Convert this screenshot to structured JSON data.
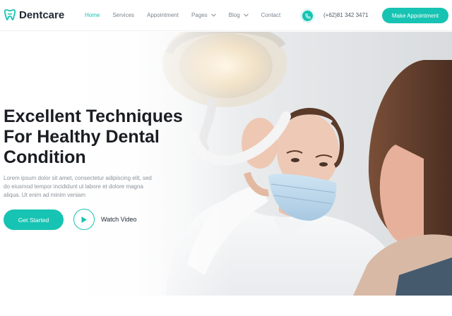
{
  "brand": {
    "name": "Dentcare"
  },
  "nav": {
    "items": [
      {
        "label": "Home",
        "active": true,
        "dropdown": false
      },
      {
        "label": "Services",
        "active": false,
        "dropdown": false
      },
      {
        "label": "Appointment",
        "active": false,
        "dropdown": false
      },
      {
        "label": "Pages",
        "active": false,
        "dropdown": true
      },
      {
        "label": "Blog",
        "active": false,
        "dropdown": true
      },
      {
        "label": "Contact",
        "active": false,
        "dropdown": false
      }
    ]
  },
  "contact": {
    "phone": "(+62)81 342 3471",
    "icon": "phone-icon"
  },
  "header_cta": {
    "label": "Make Appointment"
  },
  "hero": {
    "title_lines": [
      "Excellent Techniques",
      "For Healthy Dental",
      "Condition"
    ],
    "text_lines": [
      "Lorem ipsum dolor sit amet, consectetur adipiscing elit, sed",
      "do eiusmod tempor incididunt ut labore et dolore magna",
      "aliqua. Ut enim ad minim veniam"
    ],
    "primary_button": "Get Started",
    "video_label": "Watch Video",
    "video_icon": "play-icon"
  },
  "colors": {
    "accent": "#17c3b2",
    "accent_light": "#e2f7f5",
    "heading": "#1a1d21",
    "nav_text": "#7b8590",
    "body_text": "#8a929a"
  }
}
